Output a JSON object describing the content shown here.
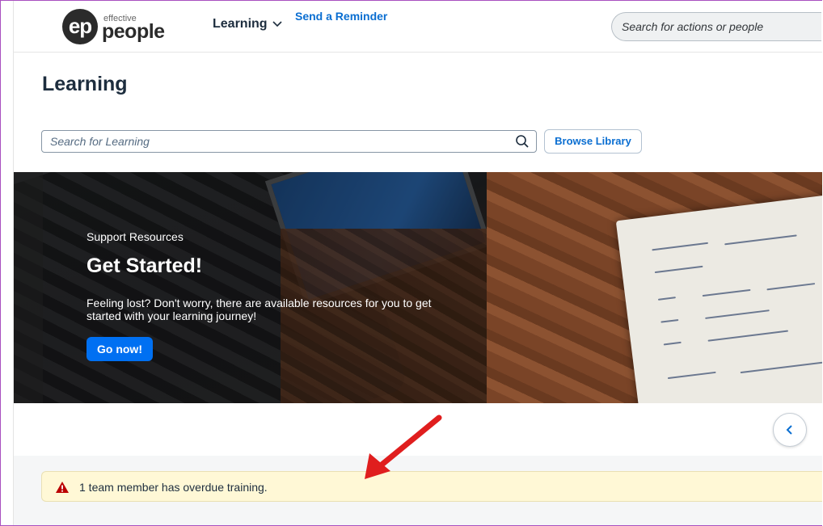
{
  "header": {
    "logo_mark": "ep",
    "logo_small": "effective",
    "logo_name": "people",
    "menu_label": "Learning",
    "search_placeholder": "Search for actions or people"
  },
  "page": {
    "title": "Learning",
    "search_placeholder": "Search for Learning",
    "browse_label": "Browse Library"
  },
  "banner": {
    "subtitle": "Support Resources",
    "title": "Get Started!",
    "description": "Feeling lost? Don't worry, there are available resources for you to get started with your learning journey!",
    "cta_label": "Go now!"
  },
  "alert": {
    "text": "1 team member has overdue training.",
    "link_label": "Send a Reminder",
    "status_color": "#bb0000"
  },
  "annotation": {
    "arrow_color": "#e01e1e"
  }
}
